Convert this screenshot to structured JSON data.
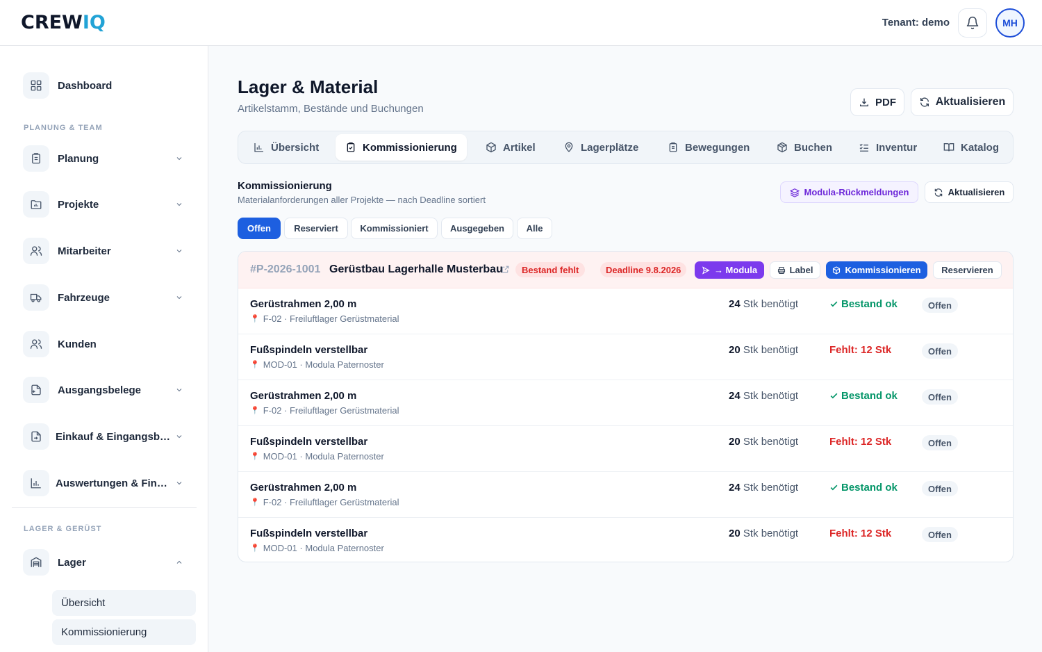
{
  "topbar": {
    "logo_main": "CREW",
    "logo_accent": "IQ",
    "tenant": "Tenant: demo",
    "avatar_initials": "MH"
  },
  "sidebar": {
    "dashboard": "Dashboard",
    "section_planning": "PLANUNG & TEAM",
    "items": [
      {
        "label": "Planung"
      },
      {
        "label": "Projekte"
      },
      {
        "label": "Mitarbeiter"
      },
      {
        "label": "Fahrzeuge"
      },
      {
        "label": "Kunden"
      },
      {
        "label": "Ausgangsbelege"
      },
      {
        "label": "Einkauf & Eingangsbelege"
      },
      {
        "label": "Auswertungen & Finanzen"
      }
    ],
    "section_storage": "LAGER & GERÜST",
    "lager": "Lager",
    "sub_items": [
      {
        "label": "Übersicht"
      },
      {
        "label": "Kommissionierung"
      }
    ]
  },
  "header": {
    "title": "Lager & Material",
    "subtitle": "Artikelstamm, Bestände und Buchungen",
    "pdf_label": "PDF",
    "refresh_label": "Aktualisieren"
  },
  "tabs": [
    {
      "label": "Übersicht"
    },
    {
      "label": "Kommissionierung"
    },
    {
      "label": "Artikel"
    },
    {
      "label": "Lagerplätze"
    },
    {
      "label": "Bewegungen"
    },
    {
      "label": "Buchen"
    },
    {
      "label": "Inventur"
    },
    {
      "label": "Katalog"
    }
  ],
  "section": {
    "title": "Kommissionierung",
    "subtitle": "Materialanforderungen aller Projekte — nach Deadline sortiert",
    "modula_button": "Modula-Rückmeldungen",
    "refresh_button": "Aktualisieren"
  },
  "filters": [
    {
      "label": "Offen"
    },
    {
      "label": "Reserviert"
    },
    {
      "label": "Kommissioniert"
    },
    {
      "label": "Ausgegeben"
    },
    {
      "label": "Alle"
    }
  ],
  "project": {
    "number": "#P-2026-1001",
    "name": "Gerüstbau Lagerhalle Musterbau",
    "badge_stock": "Bestand fehlt",
    "badge_deadline": "Deadline 9.8.2026",
    "btn_modula": "→ Modula",
    "btn_label": "Label",
    "btn_pick": "Kommissionieren",
    "btn_reserve": "Reservieren"
  },
  "rows": [
    {
      "name": "Gerüstrahmen 2,00 m",
      "location": "F-02 · Freiluftlager Gerüstmaterial",
      "qty": "24",
      "qty_unit": "Stk benötigt",
      "stock": "Bestand ok",
      "status": "Offen"
    },
    {
      "name": "Fußspindeln verstellbar",
      "location": "MOD-01 · Modula Paternoster",
      "qty": "20",
      "qty_unit": "Stk benötigt",
      "stock": "Fehlt: 12 Stk",
      "status": "Offen"
    },
    {
      "name": "Gerüstrahmen 2,00 m",
      "location": "F-02 · Freiluftlager Gerüstmaterial",
      "qty": "24",
      "qty_unit": "Stk benötigt",
      "stock": "Bestand ok",
      "status": "Offen"
    },
    {
      "name": "Fußspindeln verstellbar",
      "location": "MOD-01 · Modula Paternoster",
      "qty": "20",
      "qty_unit": "Stk benötigt",
      "stock": "Fehlt: 12 Stk",
      "status": "Offen"
    },
    {
      "name": "Gerüstrahmen 2,00 m",
      "location": "F-02 · Freiluftlager Gerüstmaterial",
      "qty": "24",
      "qty_unit": "Stk benötigt",
      "stock": "Bestand ok",
      "status": "Offen"
    },
    {
      "name": "Fußspindeln verstellbar",
      "location": "MOD-01 · Modula Paternoster",
      "qty": "20",
      "qty_unit": "Stk benötigt",
      "stock": "Fehlt: 12 Stk",
      "status": "Offen"
    }
  ],
  "colors": {
    "primary": "#1d5fe0",
    "modula": "#7c3aed",
    "ok": "#059669",
    "danger": "#dc2626",
    "logo_accent": "#22a3d6"
  }
}
